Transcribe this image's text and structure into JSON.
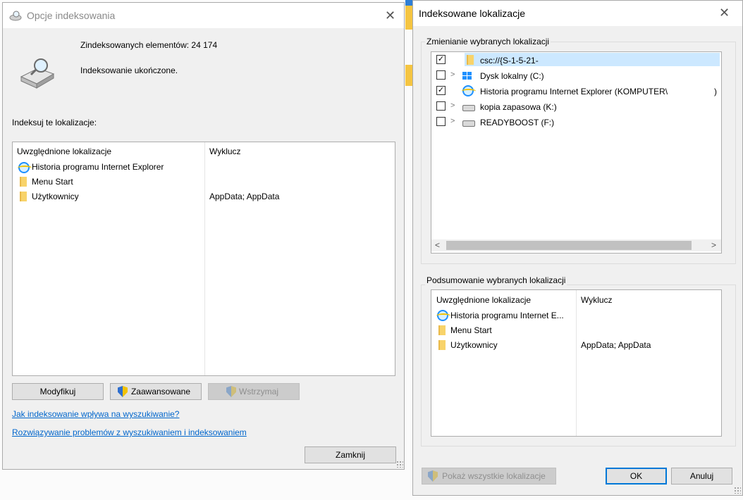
{
  "win1": {
    "title": "Opcje indeksowania",
    "indexed_count_text": "Zindeksowanych elementów: 24 174",
    "status_text": "Indeksowanie ukończone.",
    "section_label": "Indeksuj te lokalizacje:",
    "columns": {
      "included": "Uwzględnione lokalizacje",
      "exclude": "Wyklucz"
    },
    "rows": [
      {
        "icon": "ie-icon",
        "name": "Historia programu Internet Explorer",
        "exclude": ""
      },
      {
        "icon": "folder-icon",
        "name": "Menu Start",
        "exclude": ""
      },
      {
        "icon": "folder-icon",
        "name": "Użytkownicy",
        "exclude": "AppData; AppData"
      }
    ],
    "buttons": {
      "modify": "Modyfikuj",
      "advanced": "Zaawansowane",
      "pause": "Wstrzymaj",
      "close": "Zamknij"
    },
    "links": {
      "how_affects": "Jak indeksowanie wpływa na wyszukiwanie?",
      "troubleshoot": "Rozwiązywanie problemów z wyszukiwaniem i indeksowaniem"
    }
  },
  "win2": {
    "title": "Indeksowane lokalizacje",
    "change_group_label": "Zmienianie wybranych lokalizacji",
    "tree": [
      {
        "checked": true,
        "expandable": false,
        "icon": "folder-icon",
        "label": "csc://{S-1-5-21-",
        "selected": true
      },
      {
        "checked": false,
        "expandable": true,
        "icon": "windows-drive-icon",
        "label": "Dysk lokalny (C:)"
      },
      {
        "checked": true,
        "expandable": false,
        "icon": "ie-icon",
        "label": "Historia programu Internet Explorer (KOMPUTER\\",
        "suffix": ")"
      },
      {
        "checked": false,
        "expandable": true,
        "icon": "drive-icon",
        "label": "kopia zapasowa (K:)"
      },
      {
        "checked": false,
        "expandable": true,
        "icon": "drive-icon",
        "label": "READYBOOST (F:)"
      }
    ],
    "summary_group_label": "Podsumowanie wybranych lokalizacji",
    "columns": {
      "included": "Uwzględnione lokalizacje",
      "exclude": "Wyklucz"
    },
    "summary_rows": [
      {
        "icon": "ie-icon",
        "name": "Historia programu Internet E...",
        "exclude": ""
      },
      {
        "icon": "folder-icon",
        "name": "Menu Start",
        "exclude": ""
      },
      {
        "icon": "folder-icon",
        "name": "Użytkownicy",
        "exclude": "AppData; AppData"
      }
    ],
    "buttons": {
      "show_all": "Pokaż wszystkie lokalizacje",
      "ok": "OK",
      "cancel": "Anuluj"
    }
  },
  "colors": {
    "accent": "#0078d7",
    "link": "#0066cc",
    "selection": "#cce8ff"
  }
}
